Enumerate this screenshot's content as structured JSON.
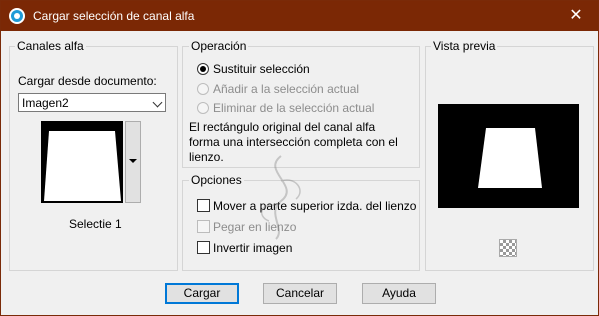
{
  "window": {
    "title": "Cargar selección de canal alfa",
    "close_glyph": "✕"
  },
  "channels": {
    "legend": "Canales alfa",
    "load_label": "Cargar desde documento:",
    "document_value": "Imagen2",
    "channel_name": "Selectie 1"
  },
  "operation": {
    "legend": "Operación",
    "options": [
      {
        "label": "Sustituir selección",
        "selected": true,
        "enabled": true
      },
      {
        "label": "Añadir a la selección actual",
        "selected": false,
        "enabled": false
      },
      {
        "label": "Eliminar de la selección actual",
        "selected": false,
        "enabled": false
      }
    ],
    "description": "El rectángulo original del canal alfa forma una intersección completa con el lienzo."
  },
  "options": {
    "legend": "Opciones",
    "items": [
      {
        "label": "Mover a parte superior izda. del lienzo",
        "checked": false,
        "enabled": true
      },
      {
        "label": "Pegar en lienzo",
        "checked": false,
        "enabled": false
      },
      {
        "label": "Invertir imagen",
        "checked": false,
        "enabled": true
      }
    ]
  },
  "preview": {
    "legend": "Vista previa"
  },
  "buttons": {
    "load": "Cargar",
    "cancel": "Cancelar",
    "help": "Ayuda"
  },
  "colors": {
    "titlebar": "#7b2805",
    "dialog_bg": "#f0f0f0",
    "accent": "#0078d7"
  }
}
